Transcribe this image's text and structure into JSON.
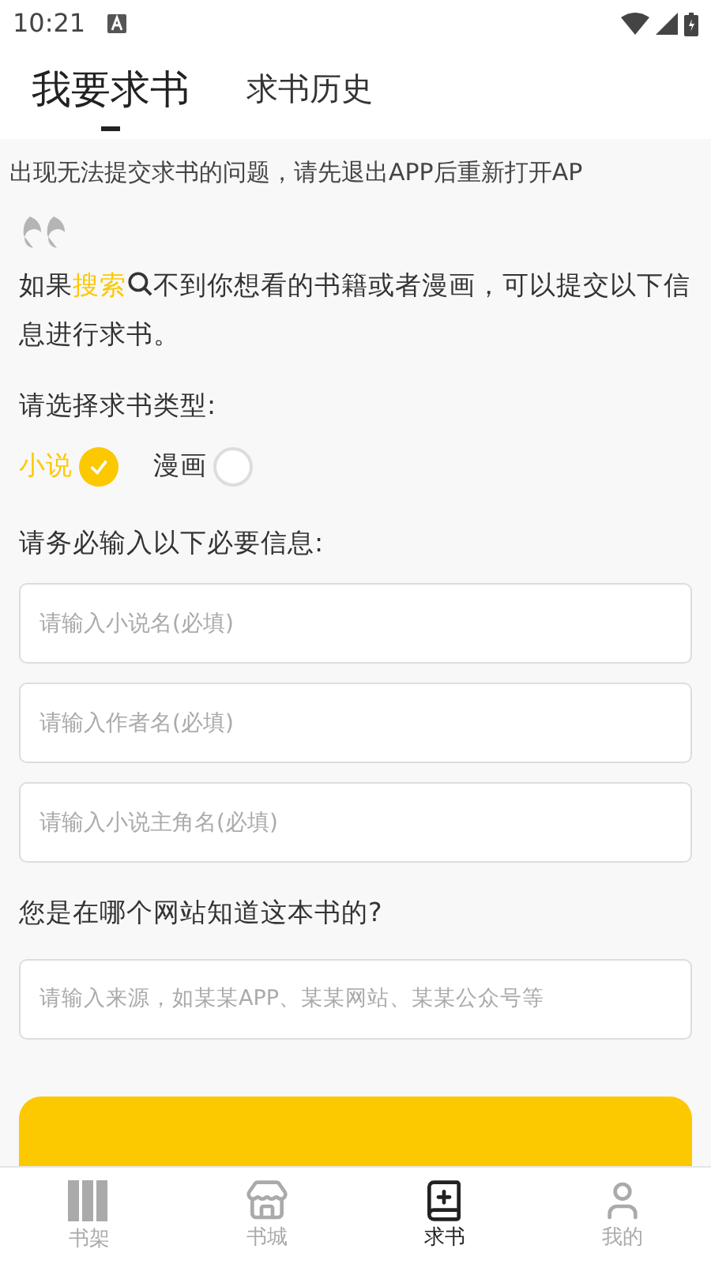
{
  "status_bar": {
    "time": "10:21"
  },
  "tabs": [
    {
      "label": "我要求书",
      "selected": true
    },
    {
      "label": "求书历史",
      "selected": false
    }
  ],
  "notice": "出现无法提交求书的问题，请先退出APP后重新打开AP",
  "intro": {
    "before": "如果",
    "link": "搜索",
    "after": "不到你想看的书籍或者漫画，可以提交以下信息进行求书。"
  },
  "type_label": "请选择求书类型:",
  "types": [
    {
      "label": "小说",
      "selected": true
    },
    {
      "label": "漫画",
      "selected": false
    }
  ],
  "required_label": "请务必输入以下必要信息:",
  "required_fields": [
    {
      "placeholder": "请输入小说名(必填)"
    },
    {
      "placeholder": "请输入作者名(必填)"
    },
    {
      "placeholder": "请输入小说主角名(必填)"
    }
  ],
  "source_label": "您是在哪个网站知道这本书的?",
  "source_field": {
    "placeholder": "请输入来源，如某某APP、某某网站、某某公众号等"
  },
  "bottom_nav": [
    {
      "label": "书架",
      "selected": false,
      "kind": "shelf"
    },
    {
      "label": "书城",
      "selected": false,
      "kind": "store"
    },
    {
      "label": "求书",
      "selected": true,
      "kind": "request"
    },
    {
      "label": "我的",
      "selected": false,
      "kind": "profile"
    }
  ]
}
